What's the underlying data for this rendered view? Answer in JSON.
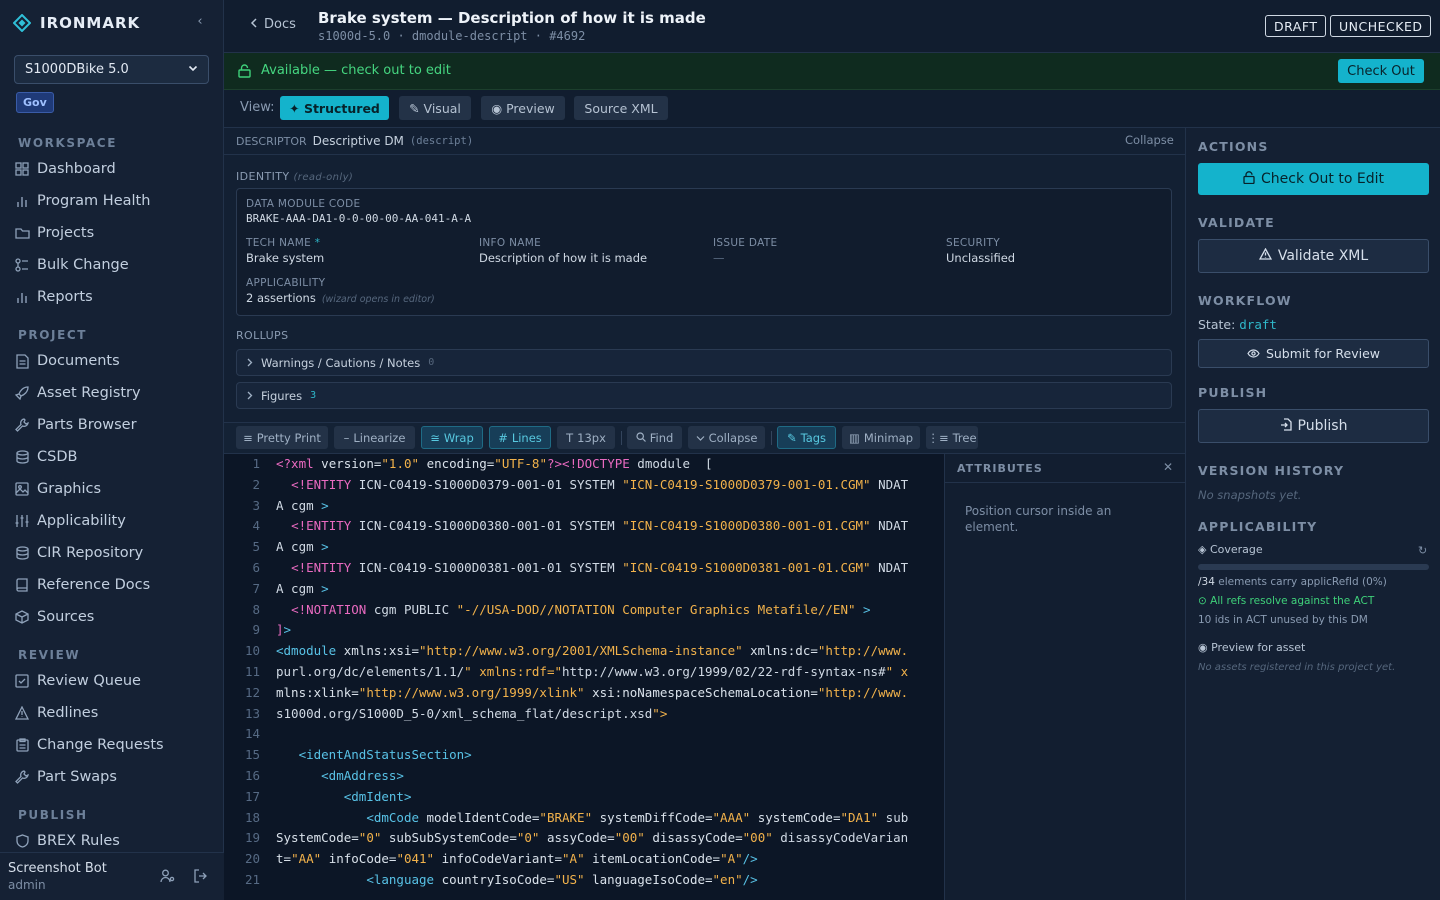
{
  "brand": {
    "name": "IRONMARK"
  },
  "sidebar": {
    "project_select": "S1000DBike 5.0",
    "badge": "Gov",
    "sections": {
      "workspace": "WORKSPACE",
      "project": "PROJECT",
      "review": "REVIEW",
      "publish": "PUBLISH"
    },
    "workspace_items": [
      "Dashboard",
      "Program Health",
      "Projects",
      "Bulk Change",
      "Reports"
    ],
    "project_items": [
      "Documents",
      "Asset Registry",
      "Parts Browser",
      "CSDB",
      "Graphics",
      "Applicability",
      "CIR Repository",
      "Reference Docs",
      "Sources"
    ],
    "review_items": [
      "Review Queue",
      "Redlines",
      "Change Requests",
      "Part Swaps"
    ],
    "publish_items": [
      "BREX Rules"
    ],
    "user": {
      "name": "Screenshot Bot",
      "role": "admin"
    }
  },
  "header": {
    "back": "Docs",
    "title": "Brake system — Description of how it is made",
    "subtitle": "s1000d-5.0 · dmodule-descript · #4692",
    "badges": [
      "DRAFT",
      "UNCHECKED"
    ]
  },
  "status": {
    "text": "Available — check out to edit",
    "button": "Check Out"
  },
  "view": {
    "label": "View:",
    "tabs": [
      "✦ Structured",
      "✎ Visual",
      "◉ Preview",
      "Source XML"
    ]
  },
  "descriptor": {
    "label": "DESCRIPTOR",
    "value": "Descriptive DM",
    "code": "(descript)",
    "collapse": "Collapse"
  },
  "identity": {
    "label": "IDENTITY",
    "note": "(read-only)",
    "dmc_label": "DATA MODULE CODE",
    "dmc": "BRAKE-AAA-DA1-0-0-00-00-AA-041-A-A",
    "tech_label": "TECH NAME",
    "tech_star": "*",
    "tech": "Brake system",
    "info_label": "INFO NAME",
    "info": "Description of how it is made",
    "issue_label": "ISSUE DATE",
    "issue": "—",
    "security_label": "SECURITY",
    "security": "Unclassified",
    "app_label": "APPLICABILITY",
    "app": "2 assertions",
    "app_note": "(wizard opens in editor)"
  },
  "rollups": {
    "label": "ROLLUPS",
    "items": [
      {
        "name": "Warnings / Cautions / Notes",
        "count": "0"
      },
      {
        "name": "Figures",
        "count": "3"
      }
    ]
  },
  "toolbar": {
    "buttons": [
      "Pretty Print",
      "Linearize",
      "Wrap",
      "Lines",
      "13px",
      "Find",
      "Collapse",
      "Tags",
      "Minimap",
      "Tree"
    ]
  },
  "editor": {
    "line_numbers": [
      "1",
      "2",
      "3",
      "4",
      "5",
      "6",
      "7",
      "8",
      "9",
      "10",
      "11",
      "12",
      "13",
      "14",
      "15",
      "16",
      "17",
      "18",
      "19",
      "20",
      "21"
    ],
    "lines": [
      "<?xml version=\"1.0\" encoding=\"UTF-8\"?><!DOCTYPE dmodule  [",
      "  <!ENTITY ICN-C0419-S1000D0379-001-01 SYSTEM \"ICN-C0419-S1000D0379-001-01.CGM\" NDAT",
      "A cgm >",
      "  <!ENTITY ICN-C0419-S1000D0380-001-01 SYSTEM \"ICN-C0419-S1000D0380-001-01.CGM\" NDAT",
      "A cgm >",
      "  <!ENTITY ICN-C0419-S1000D0381-001-01 SYSTEM \"ICN-C0419-S1000D0381-001-01.CGM\" NDAT",
      "A cgm >",
      "  <!NOTATION cgm PUBLIC \"-//USA-DOD//NOTATION Computer Graphics Metafile//EN\" >",
      "]>",
      "<dmodule xmlns:xsi=\"http://www.w3.org/2001/XMLSchema-instance\" xmlns:dc=\"http://www.",
      "purl.org/dc/elements/1.1/\" xmlns:rdf=\"http://www.w3.org/1999/02/22-rdf-syntax-ns#\" x",
      "mlns:xlink=\"http://www.w3.org/1999/xlink\" xsi:noNamespaceSchemaLocation=\"http://www.",
      "s1000d.org/S1000D_5-0/xml_schema_flat/descript.xsd\">",
      "",
      "   <identAndStatusSection>",
      "      <dmAddress>",
      "         <dmIdent>",
      "            <dmCode modelIdentCode=\"BRAKE\" systemDiffCode=\"AAA\" systemCode=\"DA1\" sub",
      "SystemCode=\"0\" subSubSystemCode=\"0\" assyCode=\"00\" disassyCode=\"00\" disassyCodeVarian",
      "t=\"AA\" infoCode=\"041\" infoCodeVariant=\"A\" itemLocationCode=\"A\"/>",
      "            <language countryIsoCode=\"US\" languageIsoCode=\"en\"/>"
    ]
  },
  "attributes": {
    "title": "ATTRIBUTES",
    "message": "Position cursor inside an element."
  },
  "right": {
    "actions_label": "ACTIONS",
    "checkout": "Check Out to Edit",
    "validate_label": "VALIDATE",
    "validate": "Validate XML",
    "workflow_label": "WORKFLOW",
    "state_label": "State:",
    "state": "draft",
    "submit": "Submit for Review",
    "publish_label": "PUBLISH",
    "publish": "Publish",
    "history_label": "VERSION HISTORY",
    "history_empty": "No snapshots yet.",
    "applicability_label": "APPLICABILITY",
    "coverage": "Coverage",
    "coverage_pct": 0,
    "coverage_total": "/34",
    "coverage_text": "elements carry applicRefId (0%)",
    "refs_ok": "All refs resolve against the ACT",
    "unused": "10 ids in ACT unused by this DM",
    "preview": "Preview for asset",
    "no_assets": "No assets registered in this project yet."
  },
  "colors": {
    "accent": "#14b3cc",
    "success": "#3fd17a",
    "tag": "#e96ac0",
    "string": "#f2b24b"
  }
}
